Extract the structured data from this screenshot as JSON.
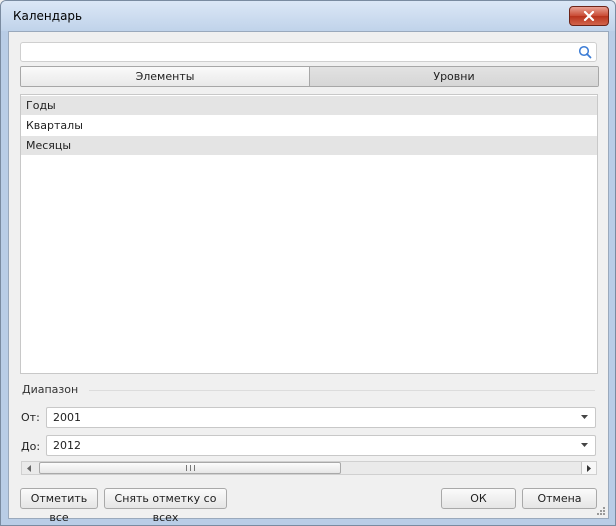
{
  "window": {
    "title": "Календарь"
  },
  "search": {
    "value": "",
    "placeholder": "",
    "icon": "search-icon"
  },
  "tabs": [
    {
      "label": "Элементы",
      "active": false
    },
    {
      "label": "Уровни",
      "active": true
    }
  ],
  "levels": [
    {
      "label": "Годы",
      "shaded": true
    },
    {
      "label": "Кварталы",
      "shaded": false
    },
    {
      "label": "Месяцы",
      "shaded": true
    }
  ],
  "range": {
    "label": "Диапазон",
    "from": {
      "label": "От:",
      "value": "2001"
    },
    "to": {
      "label": "До:",
      "value": "2012"
    }
  },
  "buttons": {
    "select_all": "Отметить все",
    "clear_all": "Снять отметку со всех",
    "ok": "ОК",
    "cancel": "Отмена"
  },
  "colors": {
    "close_button": "#c94a33",
    "list_shaded": "#e4e4e4",
    "search_icon": "#3a7bd5"
  }
}
